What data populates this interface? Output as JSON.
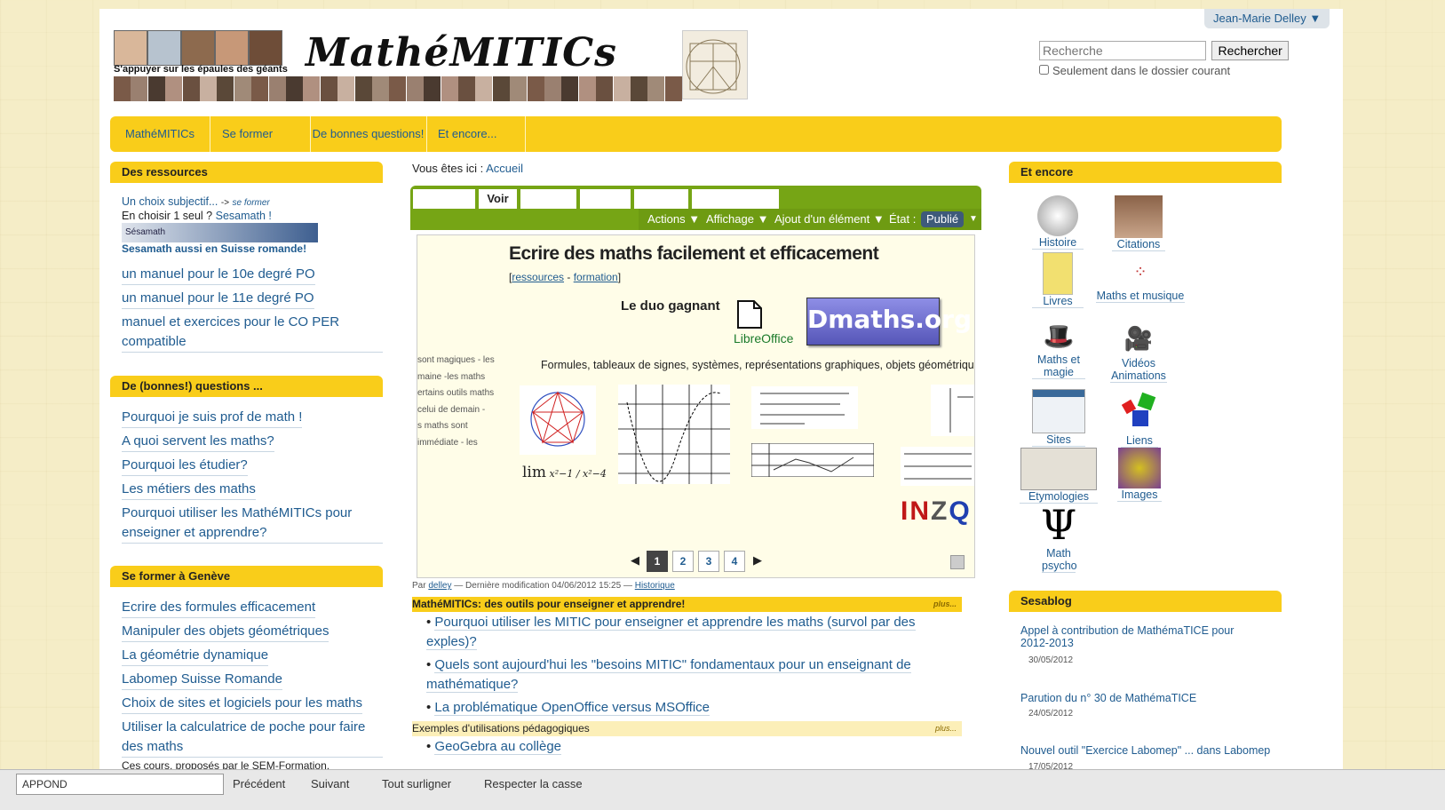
{
  "header": {
    "user_menu": "Jean-Marie Delley ▼",
    "logo_title": "MathéMITICs",
    "logo_subtitle": "S'appuyer sur les épaules des géants",
    "search_placeholder": "Recherche",
    "search_button": "Rechercher",
    "search_option": "Seulement dans le dossier courant"
  },
  "nav": [
    "MathéMITICs",
    "Se former",
    "De bonnes questions!",
    "Et encore..."
  ],
  "left": {
    "ressources": {
      "title": "Des ressources",
      "choix_link": "Un choix subjectif...",
      "choix_arrow": "->",
      "choix_sub": "se former",
      "choisir_prefix": "En choisir 1 seul ?",
      "choisir_link": "Sesamath !",
      "sesamath_banner": "Sésamath",
      "sesamath_suisse": "Sesamath aussi en Suisse romande!",
      "links": [
        "un manuel pour le 10e degré PO",
        "un manuel pour le 11e degré PO",
        "manuel et exercices pour le CO PER compatible"
      ]
    },
    "questions": {
      "title": "De (bonnes!) questions ...",
      "links": [
        "Pourquoi je suis prof de math !",
        "A quoi servent les maths?",
        "Pourquoi les étudier?",
        "Les métiers des maths",
        "Pourquoi utiliser les MathéMITICs pour enseigner et apprendre?"
      ]
    },
    "geneve": {
      "title": "Se former à Genève",
      "links": [
        "Ecrire des formules efficacement",
        "Manipuler des objets géométriques",
        "La géométrie dynamique",
        "Labomep Suisse Romande",
        "Choix de sites et logiciels pour les maths",
        "Utiliser la calculatrice de poche pour faire des maths"
      ],
      "footer": "Ces cours, proposés par le SEM-Formation,"
    }
  },
  "content": {
    "breadcrumb_prefix": "Vous êtes ici :",
    "breadcrumb_link": "Accueil",
    "tab_voir": "Voir",
    "actions": [
      "Actions ▼",
      "Affichage ▼",
      "Ajout d'un élément ▼"
    ],
    "etat_label": "État :",
    "etat_value": "Publié",
    "etat_arrow": "▼",
    "slide": {
      "title": "Ecrire des maths facilement et efficacement",
      "bracket_open": "[",
      "link1": "ressources",
      "sep": " - ",
      "link2": "formation",
      "bracket_close": "]",
      "duo": "Le duo gagnant",
      "libreoffice": "LibreOffice",
      "dmaths": "Dmaths.org",
      "formules": "Formules, tableaux de signes, systèmes, représentations graphiques, objets géométrique",
      "left_text": [
        "sont magiques - les",
        "maine -les maths",
        "ertains outils maths",
        "celui de demain -",
        "s maths sont",
        "immédiate - les"
      ],
      "lim": "lim",
      "pages": [
        "1",
        "2",
        "3",
        "4"
      ],
      "prev": "◀",
      "next": "▶"
    },
    "byline": {
      "par": "Par",
      "author": "delley",
      "modified": "— Dernière modification 04/06/2012 15:25 —",
      "history": "Historique"
    },
    "section1": {
      "title": "MathéMITICs: des outils pour enseigner et apprendre!",
      "plus": "plus...",
      "items": [
        "Pourquoi utiliser les MITIC pour enseigner et apprendre les maths (survol par des exples)?",
        "Quels sont aujourd'hui les \"besoins MITIC\" fondamentaux pour un enseignant de mathématique?",
        "La problématique OpenOffice versus MSOffice"
      ]
    },
    "section2": {
      "title": "Exemples d'utilisations pédagogiques",
      "plus": "plus...",
      "items": [
        "GeoGebra au collège"
      ]
    }
  },
  "right": {
    "title": "Et encore",
    "icons": [
      "Histoire",
      "Citations",
      "Livres",
      "Maths et musique",
      "Maths et magie",
      "Vidéos Animations",
      "Sites",
      "Liens",
      "Etymologies",
      "Images",
      "Math psycho"
    ],
    "blog_title": "Sesablog",
    "posts": [
      {
        "title": "Appel à contribution de MathémaTICE pour 2012-2013",
        "date": "30/05/2012"
      },
      {
        "title": "Parution du n° 30 de MathémaTICE",
        "date": "24/05/2012"
      },
      {
        "title": "Nouvel outil \"Exercice Labomep\" ... dans Labomep",
        "date": "17/05/2012"
      }
    ]
  },
  "statusbar": {
    "field": "APPOND",
    "items": [
      "Précédent",
      "Suivant",
      "Tout surligner",
      "Respecter la casse"
    ]
  },
  "colors": {
    "accent": "#f9cd1a",
    "green": "#76a515",
    "link": "#205c90"
  }
}
